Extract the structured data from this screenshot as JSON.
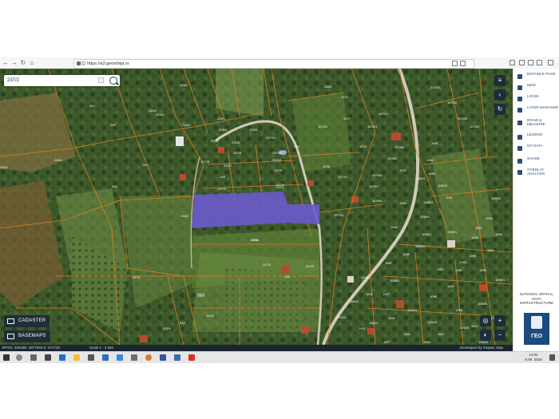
{
  "browser": {
    "url": "https://a3.geosrbija.rs"
  },
  "search": {
    "value": "237/2"
  },
  "layers": {
    "cadaster_label": "CADASTER",
    "basemaps_label": "BASEMAPS"
  },
  "status": {
    "crs": "EPSG: 32634",
    "coords": "N: 4877946 E: 471725",
    "scale": "Scale 1 : 3 294",
    "credit": "Developed by Kaspar, Map Internet"
  },
  "sidebar": {
    "items": [
      {
        "label": "EDITABLE PAGE",
        "icon": "edit-icon"
      },
      {
        "label": "NEW",
        "icon": "pin-icon"
      },
      {
        "label": "LOGIN",
        "icon": "user-icon"
      },
      {
        "label": "LAYER MANAGER",
        "icon": "layers-icon"
      },
      {
        "label": "DRAW & MEASURE",
        "icon": "pencil-icon"
      },
      {
        "label": "LEGEND",
        "icon": "list-icon"
      },
      {
        "label": "MY DATA",
        "icon": "folder-icon"
      },
      {
        "label": "SHARE",
        "icon": "share-icon"
      },
      {
        "label": "OVERLAY ANALYSIS",
        "icon": "trash-icon"
      }
    ],
    "nsdi": "NATIONAL SPATIAL DATA INFRASTRUCTURE",
    "logo_text": "ГЕО"
  },
  "taskbar": {
    "time": "14:01",
    "date": "9.09. 2018"
  },
  "parcels": [
    "245/1",
    "250",
    "245/2",
    "244/1",
    "249",
    "248/1",
    "246",
    "245/3",
    "243",
    "248/2",
    "237/1",
    "247/1",
    "246/1",
    "247/2",
    "236",
    "236/1",
    "237/2",
    "238",
    "237/7",
    "237/6",
    "237/5",
    "237/4",
    "237/3",
    "237/8",
    "237/10",
    "237/9",
    "228/1",
    "228/3",
    "233/4",
    "233/5",
    "237/11",
    "237/12",
    "235",
    "252/1",
    "252/3",
    "242",
    "242/1",
    "242/2",
    "242/3",
    "238/1",
    "1071",
    "1072/1",
    "1072/2",
    "1073",
    "1076",
    "1074/1",
    "1074/2",
    "1075/1",
    "1075/4",
    "1075/5",
    "1081",
    "1082",
    "1083",
    "1084",
    "1085",
    "1086",
    "1087",
    "1088/1",
    "1088/2",
    "1089/1",
    "1089/2",
    "1090/1",
    "1090/2",
    "1091",
    "1092",
    "1093",
    "1094",
    "1095",
    "1096",
    "1097",
    "1099",
    "1100/1",
    "1100/2",
    "1100/3",
    "1101",
    "1049",
    "1048",
    "1046",
    "1047",
    "1050/1",
    "1050/2",
    "1050/3",
    "1056/1",
    "1050/4",
    "1050/5",
    "1055/1",
    "1055/2",
    "1054",
    "1052",
    "1053",
    "1075/3",
    "1070/1",
    "1070/2",
    "1070/3",
    "1070/4",
    "1077",
    "1078/1",
    "1078/2",
    "1079",
    "1080/1",
    "1080/2",
    "1090/3",
    "1098",
    "1102",
    "1103",
    "1104",
    "1105",
    "1106",
    "1107",
    "1108",
    "1109",
    "1110",
    "1111"
  ],
  "colors": {
    "highlight": "#6a5acd",
    "parcel_line": "#e4811f",
    "sidebar_text": "#2b4e72",
    "toolbar_dark": "#1e2d3a"
  }
}
